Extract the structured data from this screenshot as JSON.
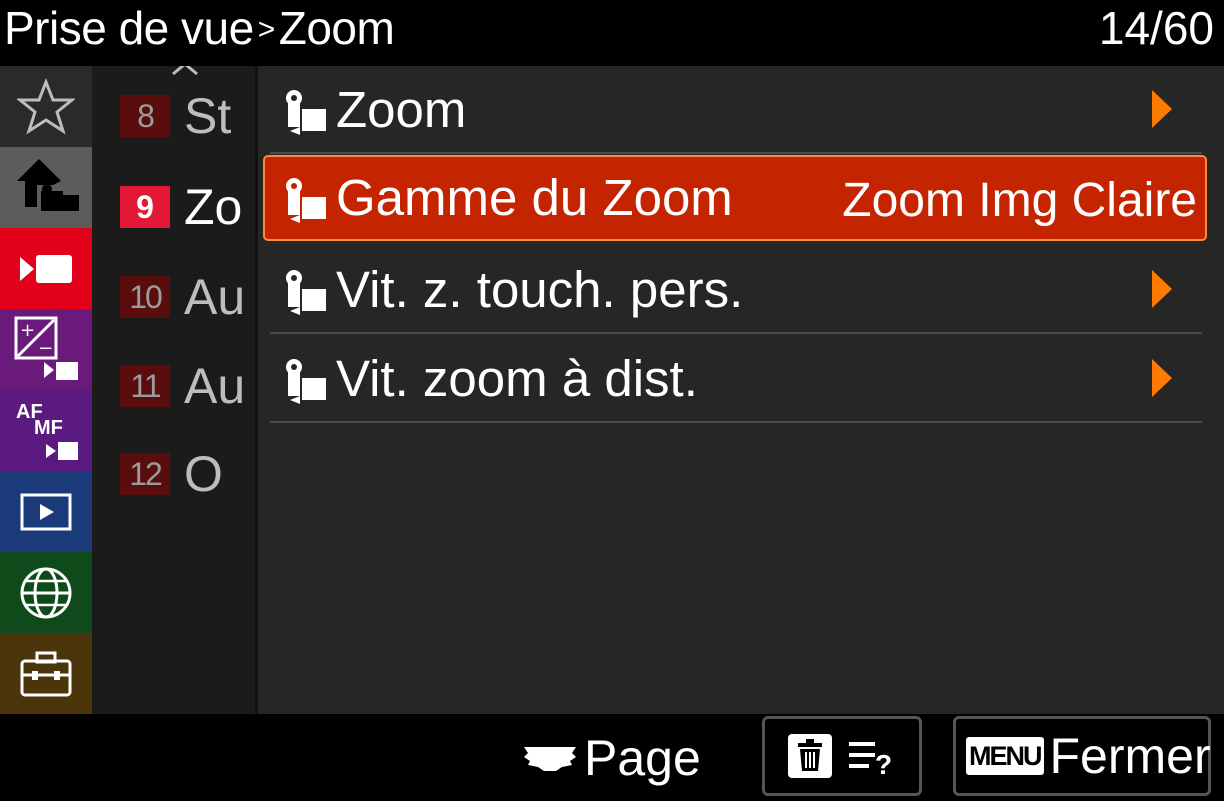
{
  "header": {
    "breadcrumb_parent": "Prise de vue",
    "breadcrumb_separator": ">",
    "breadcrumb_current": "Zoom",
    "page_counter": "14/60"
  },
  "categories": [
    {
      "name": "my-menu",
      "icon": "star-icon",
      "bg": "#2a2a2a"
    },
    {
      "name": "shooting",
      "icon": "camera-home-icon",
      "bg": "#5c5c5c",
      "selected": true
    },
    {
      "name": "movie",
      "icon": "movie-icon",
      "bg": "#e3001b"
    },
    {
      "name": "exposure-color",
      "icon": "exposure-icon",
      "bg": "#6a1a7a"
    },
    {
      "name": "focus",
      "icon": "af-mf-icon",
      "label": "AF MF",
      "bg": "#5a1a80"
    },
    {
      "name": "playback",
      "icon": "playback-icon",
      "bg": "#1a3a7a"
    },
    {
      "name": "network",
      "icon": "globe-icon",
      "bg": "#0e4a1a"
    },
    {
      "name": "setup",
      "icon": "toolbox-icon",
      "bg": "#4a360a"
    }
  ],
  "pages": [
    {
      "num": "8",
      "text": "St"
    },
    {
      "num": "9",
      "text": "Zo",
      "active": true
    },
    {
      "num": "10",
      "text": "Au"
    },
    {
      "num": "11",
      "text": "Au"
    },
    {
      "num": "12",
      "text": "O"
    }
  ],
  "items": [
    {
      "label": "Zoom",
      "icon": "camera-movie-icon",
      "arrow": true
    },
    {
      "label": "Gamme du Zoom",
      "value": "Zoom Img Claire",
      "icon": "camera-movie-icon",
      "selected": true
    },
    {
      "label": "Vit. z. touch. pers.",
      "icon": "camera-movie-icon",
      "arrow": true
    },
    {
      "label": "Vit. zoom à dist.",
      "icon": "camera-movie-icon",
      "arrow": true
    }
  ],
  "footer": {
    "page_label": "Page",
    "menu_badge": "MENU",
    "close_label": "Fermer"
  },
  "colors": {
    "selection": "#c52400",
    "selection_border": "#ff8a3a",
    "arrow": "#ff7a00",
    "active_page": "#e31837"
  }
}
